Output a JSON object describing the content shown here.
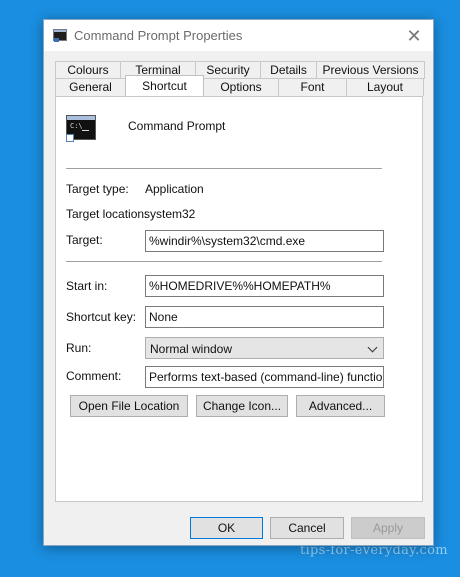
{
  "window": {
    "title": "Command Prompt Properties"
  },
  "tabs": {
    "back_row": [
      "Colours",
      "Terminal",
      "Security",
      "Details",
      "Previous Versions"
    ],
    "front_row": [
      "General",
      "Shortcut",
      "Options",
      "Font",
      "Layout"
    ],
    "active": "Shortcut"
  },
  "shortcut": {
    "app_name": "Command Prompt",
    "target_type_label": "Target type:",
    "target_type": "Application",
    "target_location_label": "Target location:",
    "target_location": "system32",
    "target_label": "Target:",
    "target": "%windir%\\system32\\cmd.exe",
    "start_in_label": "Start in:",
    "start_in": "%HOMEDRIVE%%HOMEPATH%",
    "shortcut_key_label": "Shortcut key:",
    "shortcut_key": "None",
    "run_label": "Run:",
    "run": "Normal window",
    "comment_label": "Comment:",
    "comment": "Performs text-based (command-line) functions.",
    "open_file_location": "Open File Location",
    "change_icon": "Change Icon...",
    "advanced": "Advanced..."
  },
  "footer": {
    "ok": "OK",
    "cancel": "Cancel",
    "apply": "Apply"
  },
  "watermark": "tips-for-everyday.com",
  "icons": {
    "close": "close-icon",
    "app": "command-prompt-icon"
  }
}
